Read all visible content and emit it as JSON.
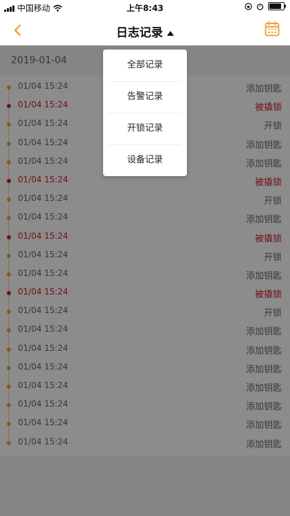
{
  "status_bar": {
    "carrier": "中国移动",
    "time": "上午8:43"
  },
  "nav": {
    "title": "日志记录",
    "accent": "#f2a23b"
  },
  "date_header": "2019-01-04",
  "colors": {
    "normal": "#666666",
    "alarm": "#d0202a",
    "dot_normal": "#f2a23b"
  },
  "logs": [
    {
      "time": "01/04 15:24",
      "action": "添加钥匙",
      "type": "normal"
    },
    {
      "time": "01/04 15:24",
      "action": "被撬锁",
      "type": "alarm"
    },
    {
      "time": "01/04 15:24",
      "action": "开锁",
      "type": "normal"
    },
    {
      "time": "01/04 15:24",
      "action": "添加钥匙",
      "type": "normal"
    },
    {
      "time": "01/04 15:24",
      "action": "添加钥匙",
      "type": "normal"
    },
    {
      "time": "01/04 15:24",
      "action": "被撬锁",
      "type": "alarm"
    },
    {
      "time": "01/04 15:24",
      "action": "开锁",
      "type": "normal"
    },
    {
      "time": "01/04 15:24",
      "action": "添加钥匙",
      "type": "normal"
    },
    {
      "time": "01/04 15:24",
      "action": "被撬锁",
      "type": "alarm"
    },
    {
      "time": "01/04 15:24",
      "action": "开锁",
      "type": "normal"
    },
    {
      "time": "01/04 15:24",
      "action": "添加钥匙",
      "type": "normal"
    },
    {
      "time": "01/04 15:24",
      "action": "被撬锁",
      "type": "alarm"
    },
    {
      "time": "01/04 15:24",
      "action": "开锁",
      "type": "normal"
    },
    {
      "time": "01/04 15:24",
      "action": "添加钥匙",
      "type": "normal"
    },
    {
      "time": "01/04 15:24",
      "action": "添加钥匙",
      "type": "normal"
    },
    {
      "time": "01/04 15:24",
      "action": "添加钥匙",
      "type": "normal"
    },
    {
      "time": "01/04 15:24",
      "action": "添加钥匙",
      "type": "normal"
    },
    {
      "time": "01/04 15:24",
      "action": "添加钥匙",
      "type": "normal"
    },
    {
      "time": "01/04 15:24",
      "action": "添加钥匙",
      "type": "normal"
    },
    {
      "time": "01/04 15:24",
      "action": "添加钥匙",
      "type": "normal"
    }
  ],
  "dropdown": {
    "items": [
      "全部记录",
      "告警记录",
      "开锁记录",
      "设备记录"
    ]
  }
}
